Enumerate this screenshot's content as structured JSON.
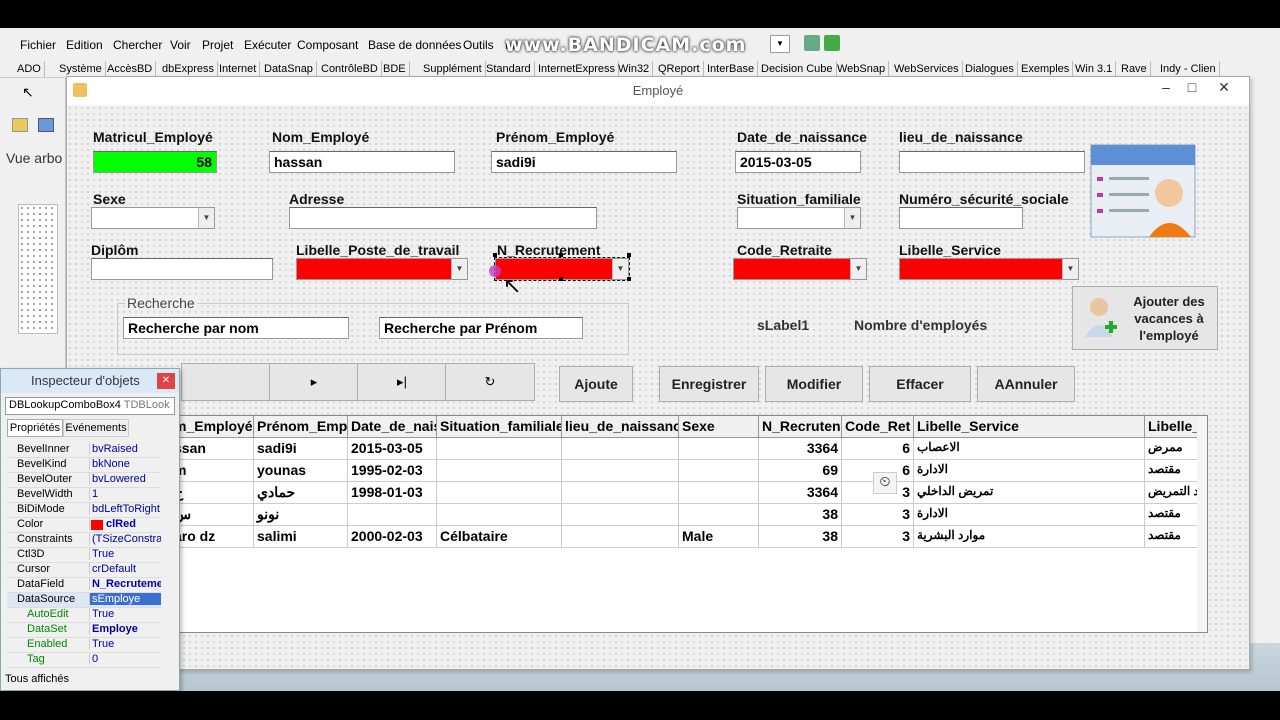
{
  "ide": {
    "menu": [
      "Fichier",
      "Edition",
      "Chercher",
      "Voir",
      "Projet",
      "Exécuter",
      "Composant",
      "Base de données",
      "Outils",
      "Mi"
    ],
    "watermark": "www.BANDICAM.com",
    "palette_tabs": [
      "ADO",
      "Système",
      "AccèsBD",
      "dbExpress",
      "Internet",
      "DataSnap",
      "ContrôleBD",
      "BDE",
      "Supplément",
      "Standard",
      "InternetExpress",
      "Win32",
      "QReport",
      "InterBase",
      "Decision Cube",
      "WebSnap",
      "WebServices",
      "Dialogues",
      "Exemples",
      "Win 3.1",
      "Rave",
      "Indy - Clien"
    ],
    "tree_label": "Vue arbo"
  },
  "form": {
    "title": "Employé",
    "labels": {
      "matricule": "Matricul_Employé",
      "nom": "Nom_Employé",
      "prenom": "Prénom_Employé",
      "date_naissance": "Date_de_naissance",
      "lieu_naissance": "lieu_de_naissance",
      "sexe": "Sexe",
      "adresse": "Adresse",
      "situation": "Situation_familiale",
      "numero_secu": "Numéro_sécurité_sociale",
      "diplom": "Diplôm",
      "libelle_poste": "Libelle_Poste_de_travail",
      "n_recrutement": "N_Recrutement",
      "code_retraite": "Code_Retraite",
      "libelle_service": "Libelle_Service"
    },
    "values": {
      "matricule": "58",
      "nom": "hassan",
      "prenom": "sadi9i",
      "date_naissance": "2015-03-05"
    },
    "search": {
      "group_label": "Recherche",
      "by_name": "Recherche par nom",
      "by_prenom": "Recherche par Prénom"
    },
    "slabel": "sLabel1",
    "count_label": "Nombre d'employés",
    "vacances_button": "Ajouter des vacances à l'employé",
    "nav": [
      "▸",
      "▸|",
      "↻"
    ],
    "buttons": {
      "ajoute": "Ajoute",
      "enregistrer": "Enregistrer",
      "modifier": "Modifier",
      "effacer": "Effacer",
      "annuler": "AAnnuler"
    },
    "colors": {
      "green": "#00ff00",
      "red": "#ff0000"
    }
  },
  "grid": {
    "headers": [
      "m_Employé",
      "Prénom_Empl",
      "Date_de_nais",
      "Situation_familiale",
      "lieu_de_naissanc",
      "Sexe",
      "N_Recruten",
      "Code_Ret",
      "Libelle_Service",
      "Libelle_P"
    ],
    "rows": [
      [
        "ssan",
        "sadi9i",
        "2015-03-05",
        "",
        "",
        "",
        "3364",
        "6",
        "الاعصاب",
        "ممرض"
      ],
      [
        "m",
        "younas",
        "1995-02-03",
        "",
        "",
        "",
        "69",
        "6",
        "الادارة",
        "مقتصد"
      ],
      [
        "ح",
        "حمادي",
        "1998-01-03",
        "",
        "",
        "",
        "3364",
        "3",
        "تمريض الداخلي",
        "اعد التمريض"
      ],
      [
        "س",
        "نونو",
        "",
        "",
        "",
        "",
        "38",
        "3",
        "الادارة",
        "مقتصد"
      ],
      [
        "aro dz",
        "salimi",
        "2000-02-03",
        "Célbataire",
        "",
        "Male",
        "38",
        "3",
        "موارد البشرية",
        "مقتصد"
      ]
    ]
  },
  "inspector": {
    "title": "Inspecteur d'objets",
    "component": "DBLookupComboBox4",
    "component_type": "TDBLook",
    "tabs": [
      "Propriétés",
      "Evénements"
    ],
    "props": [
      {
        "k": "BevelInner",
        "v": "bvRaised"
      },
      {
        "k": "BevelKind",
        "v": "bkNone"
      },
      {
        "k": "BevelOuter",
        "v": "bvLowered"
      },
      {
        "k": "BevelWidth",
        "v": "1"
      },
      {
        "k": "BiDiMode",
        "v": "bdLeftToRight"
      },
      {
        "k": "Color",
        "v": "clRed"
      },
      {
        "k": "Constraints",
        "v": "(TSizeConstrain"
      },
      {
        "k": "Ctl3D",
        "v": "True"
      },
      {
        "k": "Cursor",
        "v": "crDefault"
      },
      {
        "k": "DataField",
        "v": "N_Recruteme"
      },
      {
        "k": "DataSource",
        "v": "sEmploye"
      },
      {
        "k": "AutoEdit",
        "v": "True"
      },
      {
        "k": "DataSet",
        "v": "Employe"
      },
      {
        "k": "Enabled",
        "v": "True"
      },
      {
        "k": "Tag",
        "v": "0"
      }
    ],
    "footer": "Tous affichés"
  }
}
